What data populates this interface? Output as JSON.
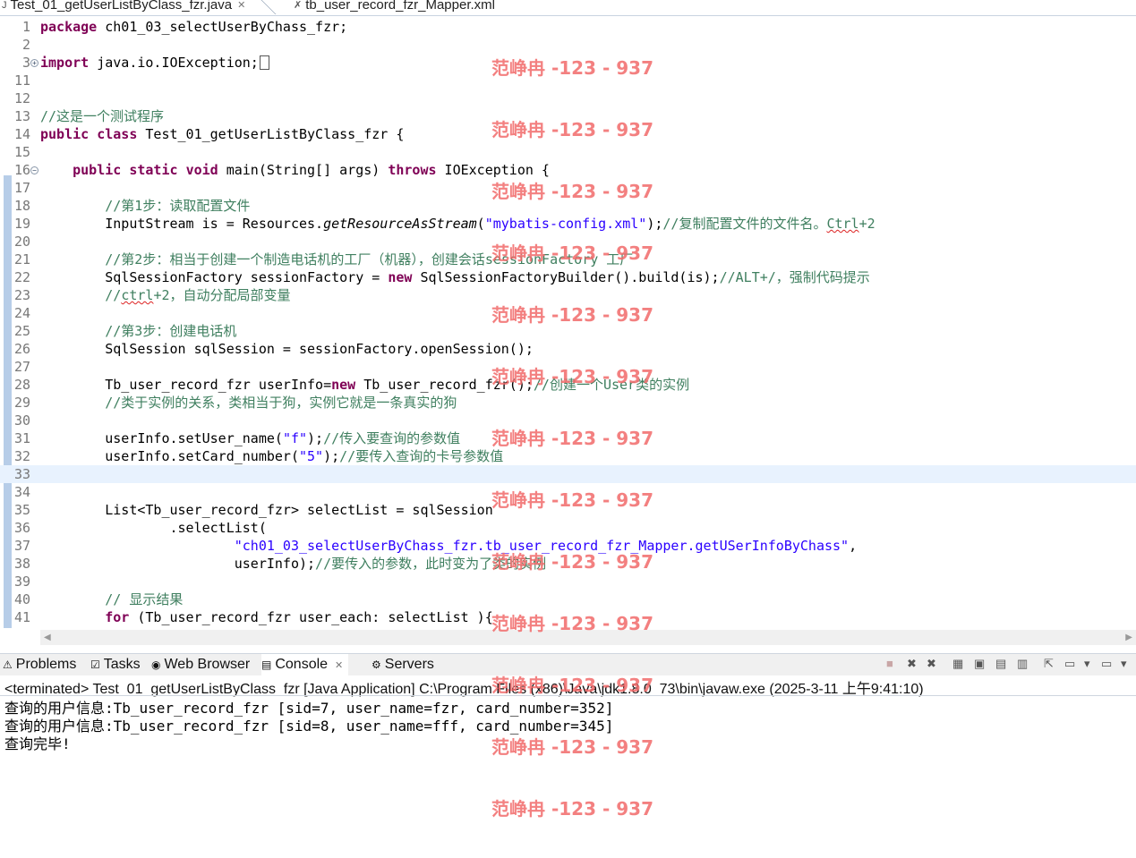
{
  "editor": {
    "tabs": [
      {
        "label": "Test_01_getUserListByClass_fzr.java",
        "active": true,
        "icon": "java-file-icon"
      },
      {
        "label": "tb_user_record_fzr_Mapper.xml",
        "active": false,
        "icon": "xml-file-icon"
      }
    ],
    "current_line": "33",
    "lines": [
      {
        "n": "1",
        "segs": [
          [
            "k",
            "package"
          ],
          [
            "t",
            " ch01_03_selectUserByChass_fzr;"
          ]
        ]
      },
      {
        "n": "2",
        "segs": []
      },
      {
        "n": "3",
        "segs": [
          [
            "k",
            "import"
          ],
          [
            "t",
            " java.io.IOException;"
          ]
        ],
        "fold": "+",
        "box": true
      },
      {
        "n": "11",
        "segs": []
      },
      {
        "n": "12",
        "segs": []
      },
      {
        "n": "13",
        "segs": [
          [
            "c",
            "//这是一个测试程序"
          ]
        ]
      },
      {
        "n": "14",
        "segs": [
          [
            "k",
            "public"
          ],
          [
            "t",
            " "
          ],
          [
            "k",
            "class"
          ],
          [
            "t",
            " Test_01_getUserListByClass_fzr {"
          ]
        ]
      },
      {
        "n": "15",
        "segs": []
      },
      {
        "n": "16",
        "segs": [
          [
            "t",
            "    "
          ],
          [
            "k",
            "public"
          ],
          [
            "t",
            " "
          ],
          [
            "k",
            "static"
          ],
          [
            "t",
            " "
          ],
          [
            "k",
            "void"
          ],
          [
            "t",
            " main(String[] args) "
          ],
          [
            "k",
            "throws"
          ],
          [
            "t",
            " IOException {"
          ]
        ],
        "fold": "−"
      },
      {
        "n": "17",
        "segs": []
      },
      {
        "n": "18",
        "segs": [
          [
            "t",
            "        "
          ],
          [
            "c",
            "//第1步：读取配置文件"
          ]
        ]
      },
      {
        "n": "19",
        "segs": [
          [
            "t",
            "        InputStream is = Resources."
          ],
          [
            "m",
            "getResourceAsStream"
          ],
          [
            "t",
            "("
          ],
          [
            "s",
            "\"mybatis-config.xml\""
          ],
          [
            "t",
            ");"
          ],
          [
            "c",
            "//复制配置文件的文件名。"
          ],
          [
            "cq",
            "Ctrl"
          ],
          [
            "c",
            "+2"
          ]
        ]
      },
      {
        "n": "20",
        "segs": []
      },
      {
        "n": "21",
        "segs": [
          [
            "t",
            "        "
          ],
          [
            "c",
            "//第2步：相当于创建一个制造电话机的工厂（机器），创建会话sessionFactory 工厂"
          ]
        ]
      },
      {
        "n": "22",
        "segs": [
          [
            "t",
            "        SqlSessionFactory sessionFactory = "
          ],
          [
            "k",
            "new"
          ],
          [
            "t",
            " SqlSessionFactoryBuilder().build(is);"
          ],
          [
            "c",
            "//ALT+/，强制代码提示"
          ]
        ]
      },
      {
        "n": "23",
        "segs": [
          [
            "t",
            "        "
          ],
          [
            "c",
            "//"
          ],
          [
            "cq",
            "ctrl"
          ],
          [
            "c",
            "+2，自动分配局部变量"
          ]
        ]
      },
      {
        "n": "24",
        "segs": []
      },
      {
        "n": "25",
        "segs": [
          [
            "t",
            "        "
          ],
          [
            "c",
            "//第3步：创建电话机"
          ]
        ]
      },
      {
        "n": "26",
        "segs": [
          [
            "t",
            "        SqlSession sqlSession = sessionFactory.openSession();"
          ]
        ]
      },
      {
        "n": "27",
        "segs": []
      },
      {
        "n": "28",
        "segs": [
          [
            "t",
            "        Tb_user_record_fzr userInfo="
          ],
          [
            "k",
            "new"
          ],
          [
            "t",
            " Tb_user_record_fzr();"
          ],
          [
            "c",
            "//创建一个User类的实例"
          ]
        ]
      },
      {
        "n": "29",
        "segs": [
          [
            "t",
            "        "
          ],
          [
            "c",
            "//类于实例的关系，类相当于狗，实例它就是一条真实的狗"
          ]
        ]
      },
      {
        "n": "30",
        "segs": []
      },
      {
        "n": "31",
        "segs": [
          [
            "t",
            "        userInfo.setUser_name("
          ],
          [
            "s",
            "\"f\""
          ],
          [
            "t",
            ");"
          ],
          [
            "c",
            "//传入要查询的参数值"
          ]
        ]
      },
      {
        "n": "32",
        "segs": [
          [
            "t",
            "        userInfo.setCard_number("
          ],
          [
            "s",
            "\"5\""
          ],
          [
            "t",
            ");"
          ],
          [
            "c",
            "//要传入查询的卡号参数值"
          ]
        ]
      },
      {
        "n": "33",
        "segs": []
      },
      {
        "n": "34",
        "segs": []
      },
      {
        "n": "35",
        "segs": [
          [
            "t",
            "        List<Tb_user_record_fzr> selectList = sqlSession"
          ]
        ]
      },
      {
        "n": "36",
        "segs": [
          [
            "t",
            "                .selectList("
          ]
        ]
      },
      {
        "n": "37",
        "segs": [
          [
            "t",
            "                        "
          ],
          [
            "s",
            "\"ch01_03_selectUserByChass_fzr.tb_user_record_fzr_Mapper.getUSerInfoByChass\""
          ],
          [
            "t",
            ","
          ]
        ]
      },
      {
        "n": "38",
        "segs": [
          [
            "t",
            "                        userInfo);"
          ],
          [
            "c",
            "//要传入的参数，此时变为了类的实例"
          ]
        ]
      },
      {
        "n": "39",
        "segs": []
      },
      {
        "n": "40",
        "segs": [
          [
            "t",
            "        "
          ],
          [
            "c",
            "// 显示结果"
          ]
        ]
      },
      {
        "n": "41",
        "segs": [
          [
            "t",
            "        "
          ],
          [
            "k",
            "for"
          ],
          [
            "t",
            " (Tb_user_record_fzr user_each: selectList ){"
          ]
        ]
      }
    ]
  },
  "views": {
    "tabs": [
      {
        "label": "Problems",
        "icon": "problems-icon",
        "active": false
      },
      {
        "label": "Tasks",
        "icon": "tasks-icon",
        "active": false
      },
      {
        "label": "Web Browser",
        "icon": "globe-icon",
        "active": false
      },
      {
        "label": "Console",
        "icon": "console-icon",
        "active": true
      },
      {
        "label": "Servers",
        "icon": "servers-icon",
        "active": false
      }
    ]
  },
  "console": {
    "header": "<terminated> Test_01_getUserListByClass_fzr [Java Application] C:\\Program Files (x86)\\Java\\jdk1.8.0_73\\bin\\javaw.exe (2025-3-11 上午9:41:10)",
    "output": [
      "查询的用户信息:Tb_user_record_fzr [sid=7, user_name=fzr, card_number=352]",
      "查询的用户信息:Tb_user_record_fzr [sid=8, user_name=fff, card_number=345]",
      "查询完毕!"
    ]
  },
  "watermark": "范峥冉 -123 - 937"
}
